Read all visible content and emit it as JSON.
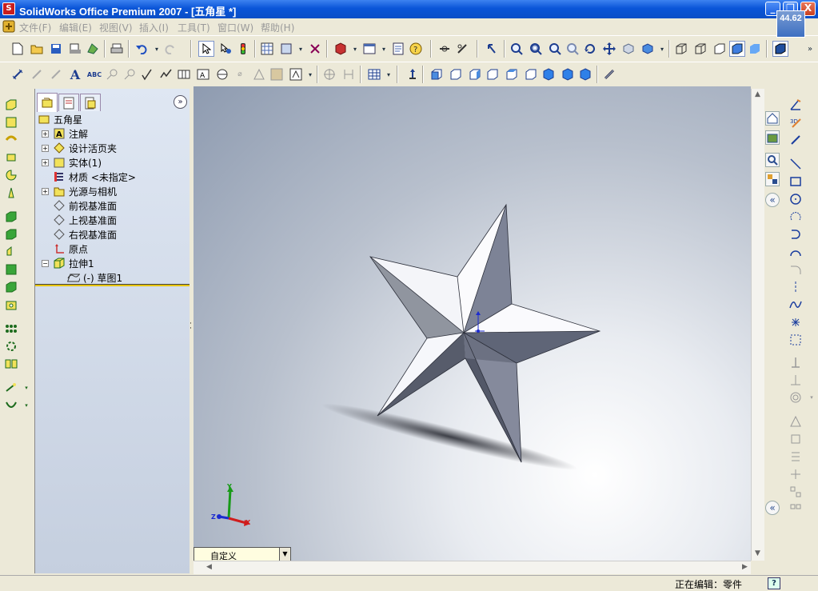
{
  "window": {
    "title": "SolidWorks Office Premium 2007 - [五角星 *]",
    "minimize_label": "_",
    "restore_label": "❐",
    "close_label": "X",
    "fps_value": "44.62"
  },
  "menu": {
    "items": [
      "文件(F)",
      "编辑(E)",
      "视图(V)",
      "插入(I)",
      "工具(T)",
      "窗口(W)",
      "帮助(H)"
    ]
  },
  "feature_tree": {
    "root": "五角星",
    "items": [
      "注解",
      "设计活页夹",
      "实体(1)",
      "材质 <未指定>",
      "光源与相机",
      "前视基准面",
      "上视基准面",
      "右视基准面",
      "原点",
      "拉伸1",
      "(-) 草图1"
    ]
  },
  "configuration": {
    "value": "自定义"
  },
  "status": {
    "text": "正在编辑：零件",
    "help": "?"
  },
  "triad": {
    "x": "X",
    "y": "Y",
    "z": "Z"
  },
  "colors": {
    "titlebar": "#0a55d8",
    "viewport": "#8e9bb0",
    "rollback_bar": "#e8c400"
  },
  "icons": {
    "toolbar1": [
      "new-icon",
      "open-icon",
      "save-icon",
      "print-icon",
      "undo-icon",
      "redo-icon",
      "select-icon",
      "rebuild-icon",
      "options-icon",
      "help-icon",
      "zoom-icon",
      "rotate-icon",
      "pan-icon",
      "view-orientation-icon",
      "display-style-icon"
    ],
    "toolbar2": [
      "smart-dimension-icon",
      "note-icon",
      "spell-check-icon",
      "surface-finish-icon",
      "weld-symbol-icon",
      "datum-icon",
      "table-icon",
      "standard-views-icon"
    ]
  }
}
